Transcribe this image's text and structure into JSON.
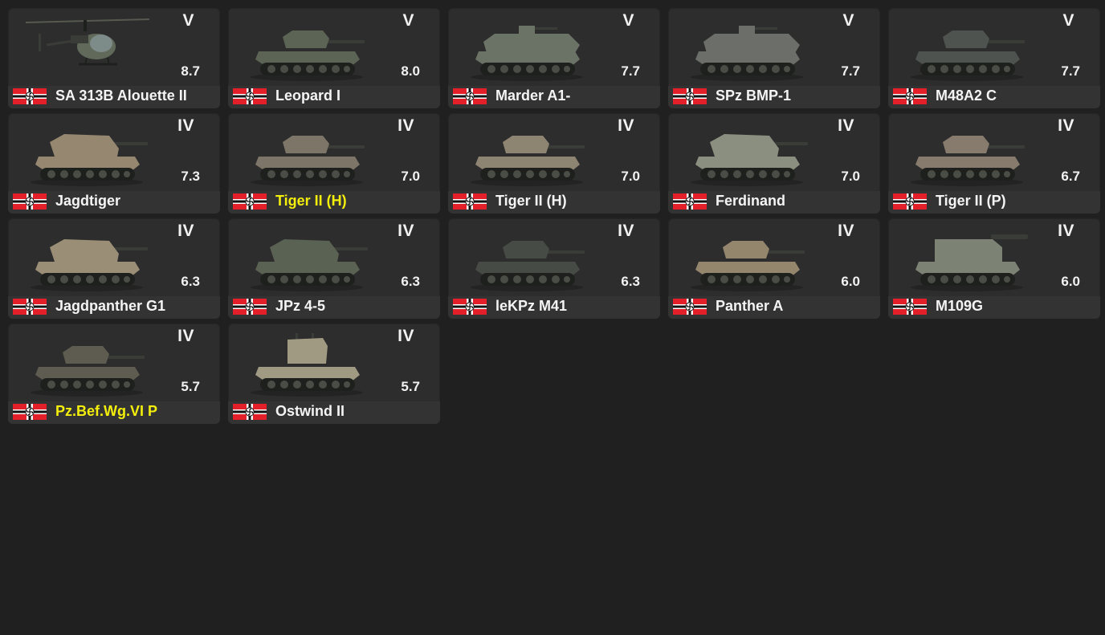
{
  "colors": {
    "background": "#202020",
    "card": "#2d2d2d",
    "text": "#f4f4f4",
    "premium_text": "#f3ee0c",
    "flag_red": "#e3202a"
  },
  "vehicles": [
    {
      "name": "SA 313B Alouette II",
      "rank": "V",
      "br": "8.7",
      "premium": false,
      "icon": "helicopter-icon",
      "hue": "#6b7563"
    },
    {
      "name": "Leopard I",
      "rank": "V",
      "br": "8.0",
      "premium": false,
      "icon": "tank-icon",
      "hue": "#5b6455"
    },
    {
      "name": "Marder A1-",
      "rank": "V",
      "br": "7.7",
      "premium": false,
      "icon": "ifv-icon",
      "hue": "#6a7366"
    },
    {
      "name": "SPz BMP-1",
      "rank": "V",
      "br": "7.7",
      "premium": false,
      "icon": "ifv-icon",
      "hue": "#6c6f69"
    },
    {
      "name": "M48A2 C",
      "rank": "V",
      "br": "7.7",
      "premium": false,
      "icon": "tank-icon",
      "hue": "#4f5350"
    },
    {
      "name": "Jagdtiger",
      "rank": "IV",
      "br": "7.3",
      "premium": false,
      "icon": "tank-destroyer-icon",
      "hue": "#958770"
    },
    {
      "name": "Tiger II (H)",
      "rank": "IV",
      "br": "7.0",
      "premium": true,
      "icon": "tank-icon",
      "hue": "#7d7567"
    },
    {
      "name": "Tiger II (H)",
      "rank": "IV",
      "br": "7.0",
      "premium": false,
      "icon": "tank-icon",
      "hue": "#8e8472"
    },
    {
      "name": "Ferdinand",
      "rank": "IV",
      "br": "7.0",
      "premium": false,
      "icon": "tank-destroyer-icon",
      "hue": "#8b8f7f"
    },
    {
      "name": "Tiger II (P)",
      "rank": "IV",
      "br": "6.7",
      "premium": false,
      "icon": "tank-icon",
      "hue": "#867b6c"
    },
    {
      "name": "Jagdpanther G1",
      "rank": "IV",
      "br": "6.3",
      "premium": false,
      "icon": "tank-destroyer-icon",
      "hue": "#9a8e77"
    },
    {
      "name": "JPz 4-5",
      "rank": "IV",
      "br": "6.3",
      "premium": false,
      "icon": "tank-destroyer-icon",
      "hue": "#596253"
    },
    {
      "name": "leKPz M41",
      "rank": "IV",
      "br": "6.3",
      "premium": false,
      "icon": "tank-icon",
      "hue": "#474b45"
    },
    {
      "name": "Panther A",
      "rank": "IV",
      "br": "6.0",
      "premium": false,
      "icon": "tank-icon",
      "hue": "#93866d"
    },
    {
      "name": "M109G",
      "rank": "IV",
      "br": "6.0",
      "premium": false,
      "icon": "spg-icon",
      "hue": "#7c8375"
    },
    {
      "name": "Pz.Bef.Wg.VI P",
      "rank": "IV",
      "br": "5.7",
      "premium": true,
      "icon": "tank-icon",
      "hue": "#5e5b50"
    },
    {
      "name": "Ostwind II",
      "rank": "IV",
      "br": "5.7",
      "premium": false,
      "icon": "spaa-icon",
      "hue": "#a09a83"
    }
  ]
}
